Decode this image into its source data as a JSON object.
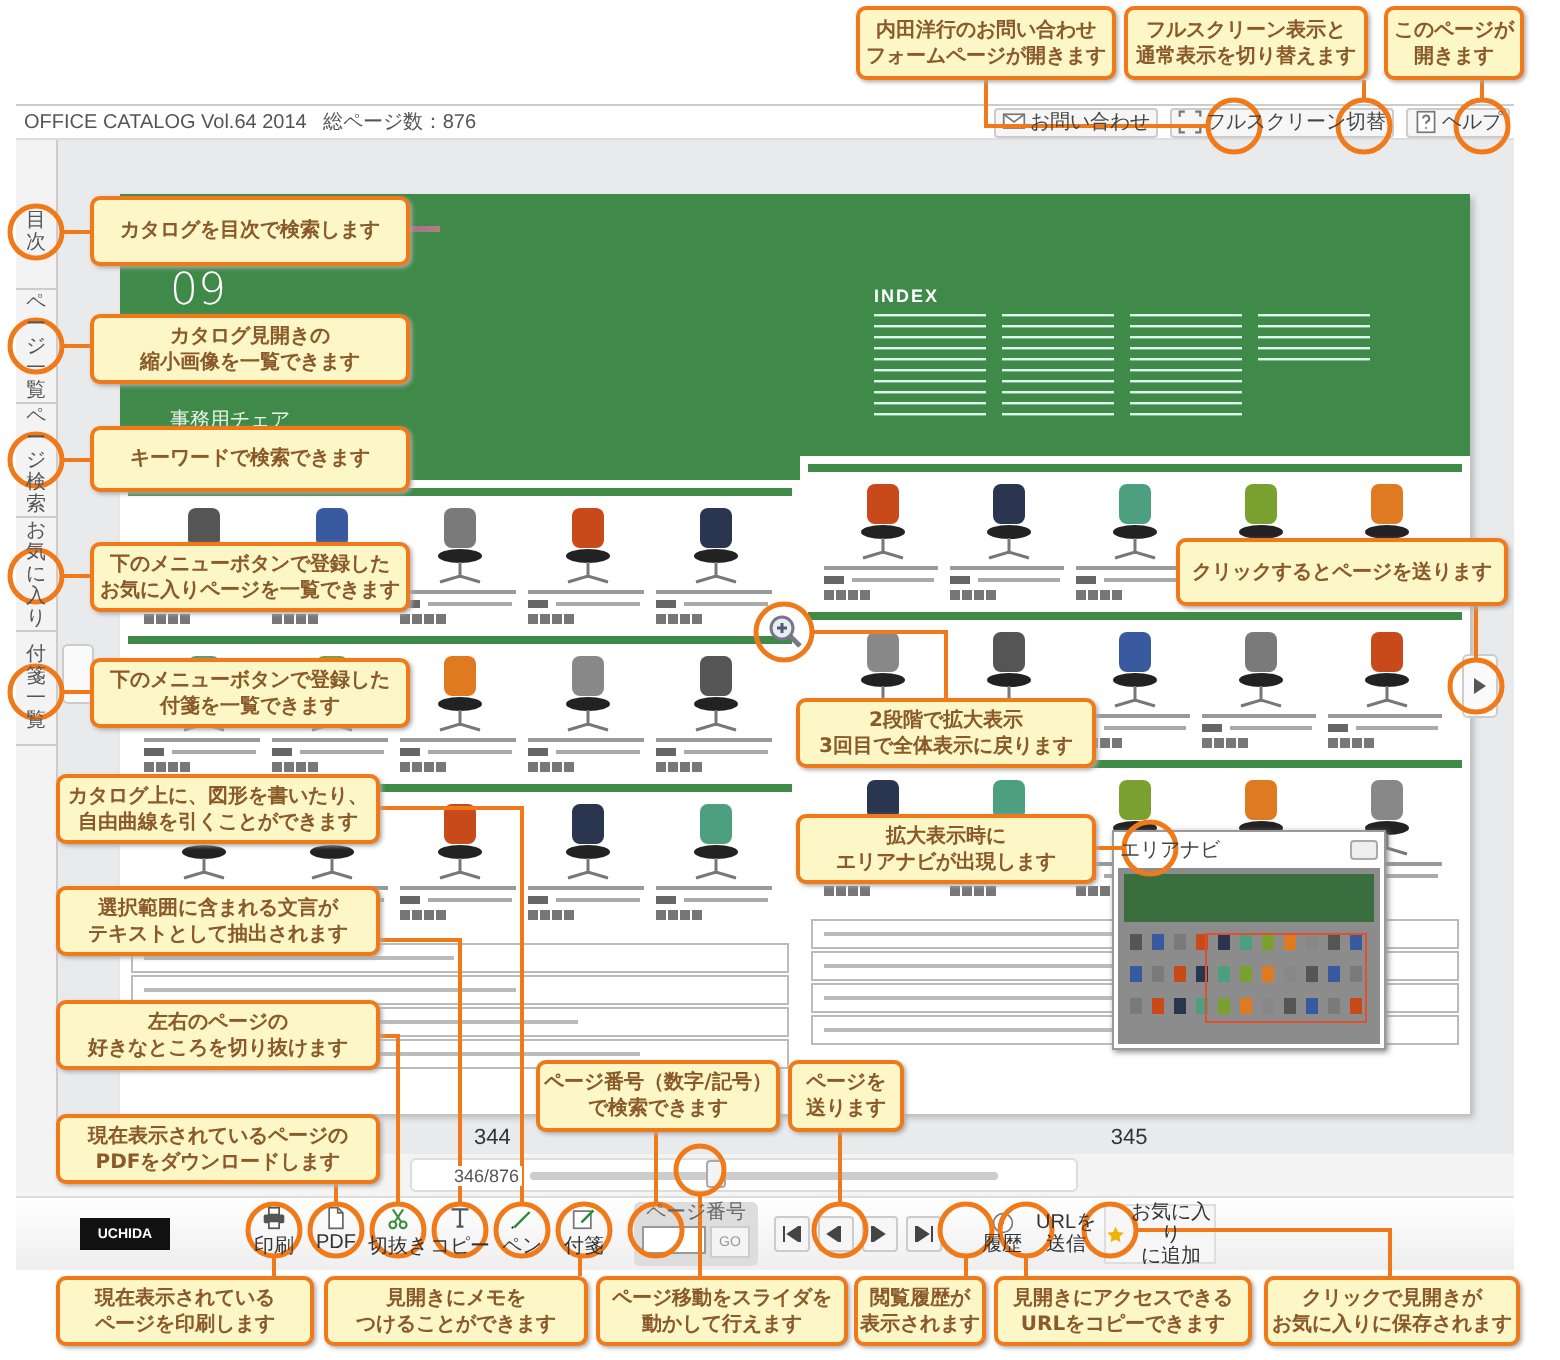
{
  "header": {
    "title": "OFFICE CATALOG Vol.64 2014",
    "page_count": "総ページ数：876",
    "buttons": [
      {
        "label": "お問い合わせ",
        "kind": "mail"
      },
      {
        "label": "フルスクリーン切替",
        "kind": "fullscreen"
      },
      {
        "label": "ヘルプ",
        "kind": "help"
      }
    ]
  },
  "side_tabs": [
    {
      "label": "目次"
    },
    {
      "label": "ページ一覧"
    },
    {
      "label": "ページ検索"
    },
    {
      "label": "お気に入り"
    },
    {
      "label": "付箋一覧"
    }
  ],
  "catalog": {
    "section_number": "09",
    "section_title": "事務用チェア",
    "index_heading": "INDEX",
    "left_page": "344",
    "right_page": "345"
  },
  "area_navi": {
    "title": "エリアナビ"
  },
  "slider": {
    "reading": "346/876",
    "level": 0.4
  },
  "toolbar": {
    "logo": "UCHIDA",
    "tools": [
      {
        "label": "印刷",
        "kind": "print"
      },
      {
        "label": "PDF",
        "kind": "pdf"
      },
      {
        "label": "切抜き",
        "kind": "cut"
      },
      {
        "label": "コピー",
        "kind": "copy"
      },
      {
        "label": "ペン",
        "kind": "pen"
      },
      {
        "label": "付箋",
        "kind": "sticky"
      }
    ],
    "page_search": {
      "label": "ページ番号",
      "go": "GO"
    },
    "nav": [
      {
        "kind": "first"
      },
      {
        "kind": "prev"
      },
      {
        "kind": "next"
      },
      {
        "kind": "last"
      }
    ],
    "extras": [
      {
        "lines": [
          "履歴"
        ],
        "kind": "history"
      },
      {
        "lines": [
          "URLを",
          "送信"
        ],
        "kind": "url"
      },
      {
        "lines": [
          "お気に入り",
          "に追加"
        ],
        "kind": "favorite"
      }
    ]
  },
  "callouts": [
    {
      "lines": [
        "内田洋行のお問い合わせ",
        "フォームページが開きます"
      ]
    },
    {
      "lines": [
        "フルスクリーン表示と",
        "通常表示を切り替えます"
      ]
    },
    {
      "lines": [
        "このページが",
        "開きます"
      ]
    },
    {
      "lines": [
        "カタログを目次で検索します"
      ]
    },
    {
      "lines": [
        "カタログ見開きの",
        "縮小画像を一覧できます"
      ]
    },
    {
      "lines": [
        "キーワードで検索できます"
      ]
    },
    {
      "lines": [
        "下のメニューボタンで登録した",
        "お気に入りページを一覧できます"
      ]
    },
    {
      "lines": [
        "クリックするとページを送ります"
      ]
    },
    {
      "lines": [
        "下のメニューボタンで登録した",
        "付箋を一覧できます"
      ]
    },
    {
      "lines": [
        "2段階で拡大表示",
        "3回目で全体表示に戻ります"
      ]
    },
    {
      "lines": [
        "カタログ上に、図形を書いたり、",
        "自由曲線を引くことができます"
      ]
    },
    {
      "lines": [
        "拡大表示時に",
        "エリアナビが出現します"
      ]
    },
    {
      "lines": [
        "選択範囲に含まれる文言が",
        "テキストとして抽出されます"
      ]
    },
    {
      "lines": [
        "左右のページの",
        "好きなところを切り抜けます"
      ]
    },
    {
      "lines": [
        "ページ番号（数字/記号）",
        "で検索できます"
      ]
    },
    {
      "lines": [
        "ページを",
        "送ります"
      ]
    },
    {
      "lines": [
        "現在表示されているページの",
        "PDFをダウンロードします"
      ]
    },
    {
      "lines": [
        "現在表示されている",
        "ページを印刷します"
      ]
    },
    {
      "lines": [
        "見開きにメモを",
        "つけることができます"
      ]
    },
    {
      "lines": [
        "ページ移動をスライダを",
        "動かして行えます"
      ]
    },
    {
      "lines": [
        "閲覧履歴が",
        "表示されます"
      ]
    },
    {
      "lines": [
        "見開きにアクセスできる",
        "URLをコピーできます"
      ]
    },
    {
      "lines": [
        "クリックで見開きが",
        "お気に入りに保存されます"
      ]
    }
  ]
}
